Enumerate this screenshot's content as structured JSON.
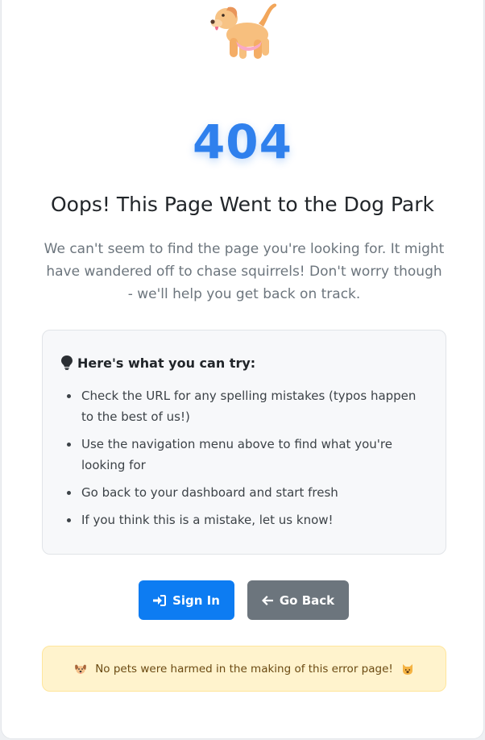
{
  "error": {
    "code": "404",
    "title": "Oops! This Page Went to the Dog Park",
    "description": "We can't seem to find the page you're looking for. It might have wandered off to chase squirrels! Don't worry though - we'll help you get back on track."
  },
  "hero_icon": "dog-icon",
  "tips": {
    "icon": "lightbulb-icon",
    "title": "Here's what you can try:",
    "items": [
      "Check the URL for any spelling mistakes (typos happen to the best of us!)",
      "Use the navigation menu above to find what you're looking for",
      "Go back to your dashboard and start fresh",
      "If you think this is a mistake, let us know!"
    ]
  },
  "actions": {
    "sign_in": {
      "label": "Sign In",
      "icon": "sign-in-icon"
    },
    "go_back": {
      "label": "Go Back",
      "icon": "arrow-left-icon"
    }
  },
  "notice": {
    "text": "No pets were harmed in the making of this error page!",
    "left_icon": "dog-face-icon",
    "right_icon": "cat-face-icon"
  },
  "colors": {
    "accent": "#2f80ed",
    "primary_button": "#0d7cf2",
    "secondary_button": "#6c757d",
    "notice_bg": "#fff3cd"
  }
}
